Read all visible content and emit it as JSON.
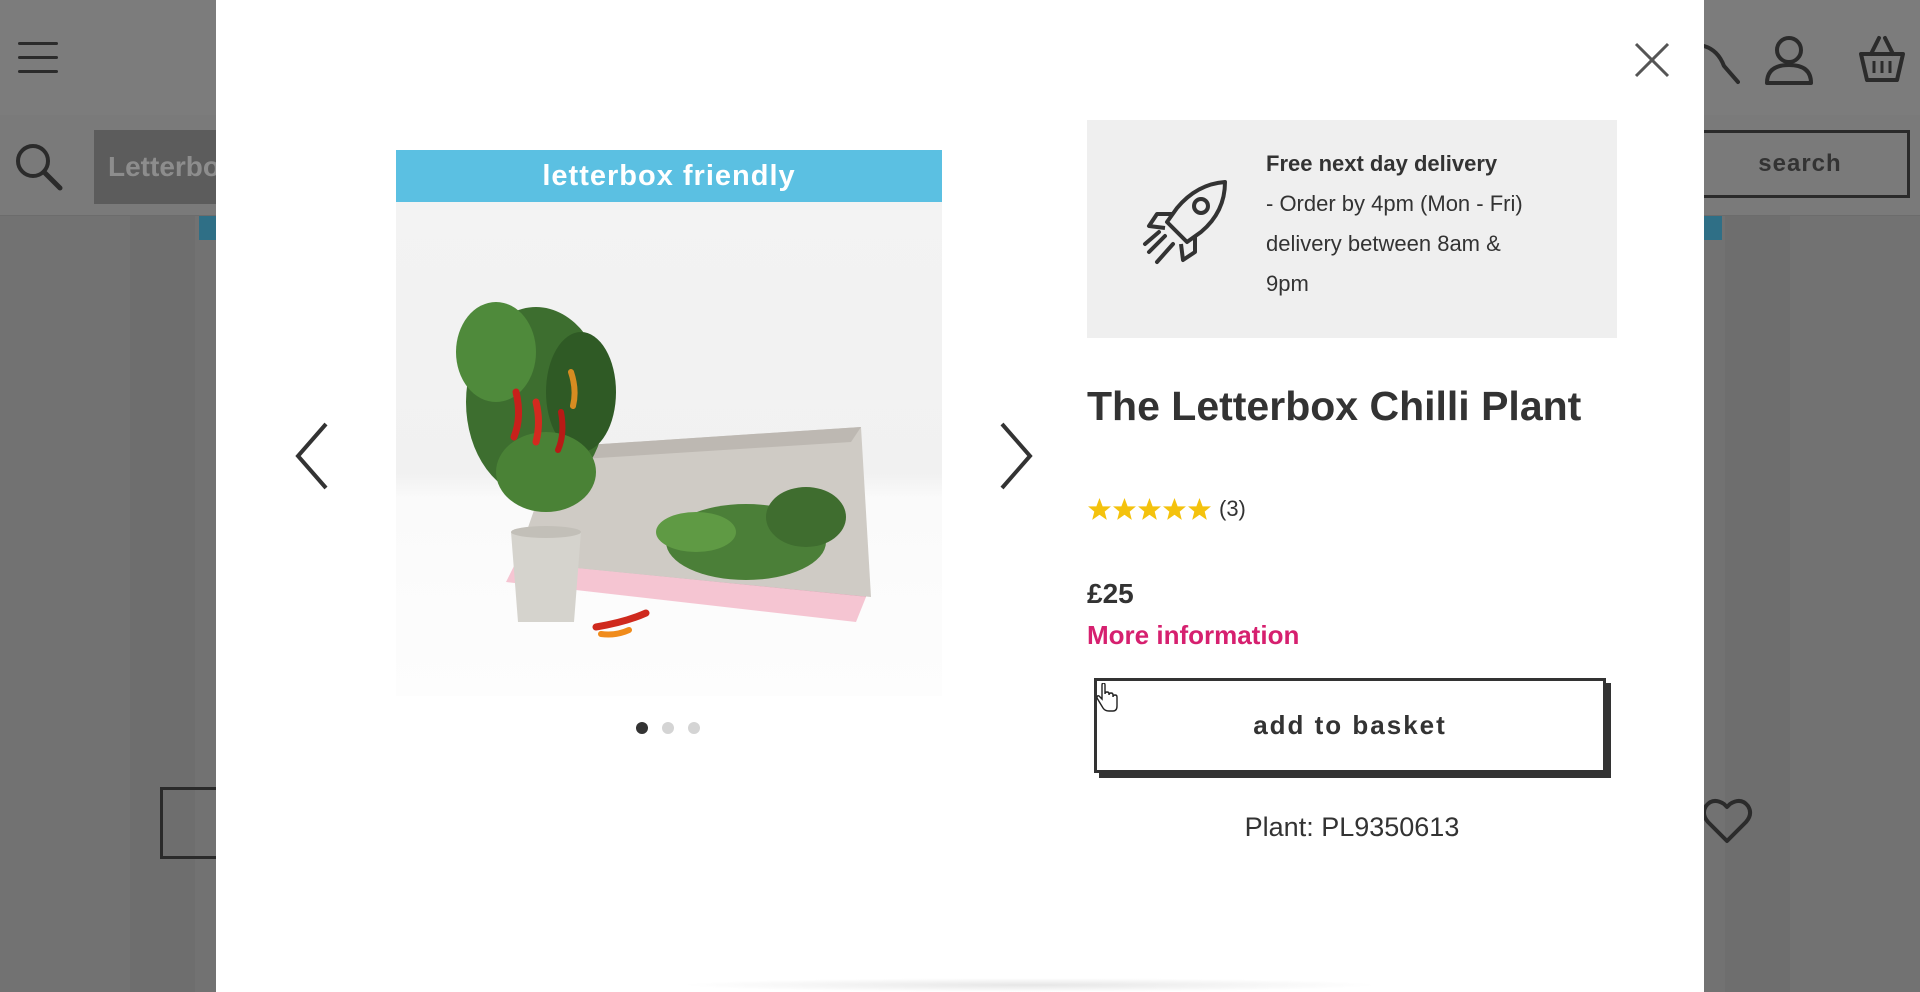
{
  "background_page": {
    "search_placeholder": "Letterbox",
    "search_button_label": "search",
    "icons": [
      "hamburger-menu-icon",
      "search-icon",
      "account-icon",
      "basket-icon",
      "heart-icon"
    ]
  },
  "modal": {
    "close_icon": "close-icon",
    "carousel": {
      "banner_text": "letterbox friendly",
      "slide_count": 3,
      "active_slide": 1,
      "prev_icon": "chevron-left-icon",
      "next_icon": "chevron-right-icon"
    },
    "delivery": {
      "icon": "rocket-icon",
      "title": "Free next day delivery",
      "line1": "- Order by 4pm (Mon - Fri)",
      "line2": "delivery between 8am &",
      "line3": "9pm"
    },
    "product": {
      "title": "The Letterbox Chilli Plant",
      "rating_stars": 5,
      "rating_count": "(3)",
      "price": "£25",
      "more_info_label": "More information",
      "add_to_basket_label": "add to basket",
      "sku": "Plant: PL9350613"
    },
    "colors": {
      "banner": "#5bc0e2",
      "link": "#d6206f",
      "star": "#f4c20d",
      "delivery_bg": "#efefef"
    }
  }
}
